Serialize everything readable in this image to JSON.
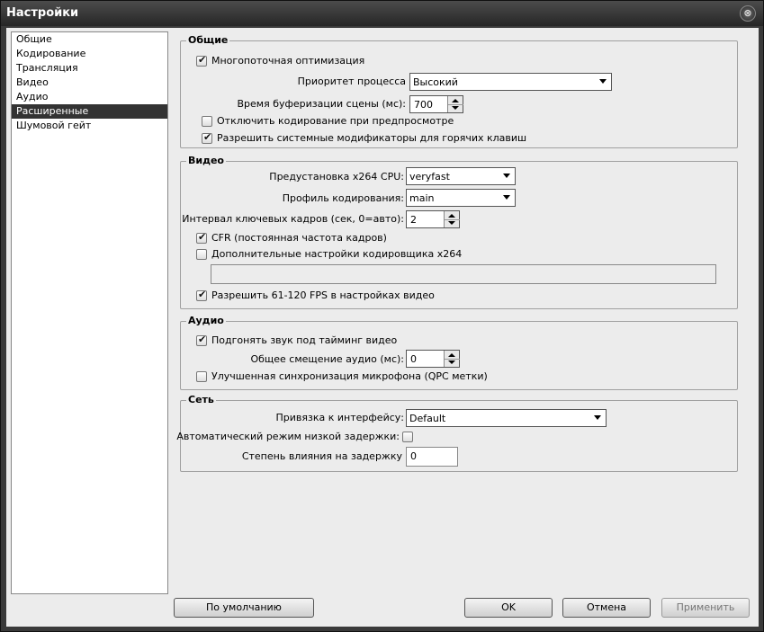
{
  "window": {
    "title": "Настройки",
    "close_glyph": "⊗"
  },
  "sidebar": {
    "items": [
      {
        "label": "Общие"
      },
      {
        "label": "Кодирование"
      },
      {
        "label": "Трансляция"
      },
      {
        "label": "Видео"
      },
      {
        "label": "Аудио"
      },
      {
        "label": "Расширенные",
        "selected": true
      },
      {
        "label": "Шумовой гейт"
      }
    ]
  },
  "general": {
    "legend": "Общие",
    "multithread_label": "Многопоточная оптимизация",
    "multithread_checked": true,
    "priority_label": "Приоритет процесса",
    "priority_value": "Высокий",
    "buffer_label": "Время буферизации сцены (мс):",
    "buffer_value": "700",
    "disable_preview_label": "Отключить кодирование при предпросмотре",
    "disable_preview_checked": false,
    "sys_modifiers_label": "Разрешить системные модификаторы для горячих клавиш",
    "sys_modifiers_checked": true
  },
  "video": {
    "legend": "Видео",
    "preset_label": "Предустановка x264 CPU:",
    "preset_value": "veryfast",
    "profile_label": "Профиль кодирования:",
    "profile_value": "main",
    "keyframe_label": "Интервал ключевых кадров (сек, 0=авто):",
    "keyframe_value": "2",
    "cfr_label": "CFR (постоянная частота кадров)",
    "cfr_checked": true,
    "x264_extra_label": "Дополнительные настройки кодировщика x264",
    "x264_extra_checked": false,
    "x264_extra_value": "",
    "fps_label": "Разрешить 61-120 FPS в настройках видео",
    "fps_checked": true
  },
  "audio": {
    "legend": "Аудио",
    "sync_label": "Подгонять звук под тайминг видео",
    "sync_checked": true,
    "offset_label": "Общее смещение аудио (мс):",
    "offset_value": "0",
    "mic_sync_label": "Улучшенная синхронизация микрофона (QPC метки)",
    "mic_sync_checked": false
  },
  "network": {
    "legend": "Сеть",
    "bind_label": "Привязка к интерфейсу:",
    "bind_value": "Default",
    "low_latency_label": "Автоматический режим низкой задержки:",
    "low_latency_checked": false,
    "latency_factor_label": "Степень влияния на задержку",
    "latency_factor_value": "0"
  },
  "buttons": {
    "defaults": "По умолчанию",
    "ok": "OK",
    "cancel": "Отмена",
    "apply": "Применить"
  }
}
